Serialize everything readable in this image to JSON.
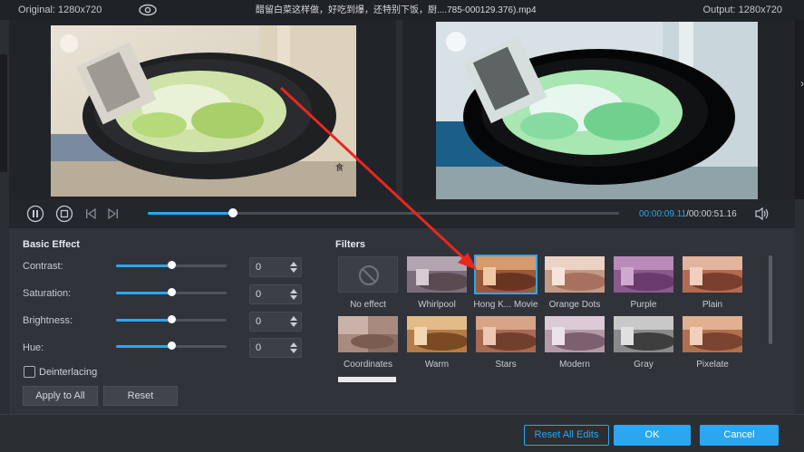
{
  "topbar": {
    "original_label": "Original: 1280x720",
    "title": "醋留白菜这样做，好吃到爆，还特别下饭，厨....785-000129.376).mp4",
    "output_label": "Output: 1280x720",
    "icon": "eye-icon"
  },
  "transport": {
    "time_current": "00:00:09.11",
    "time_total": "/00:00:51.16",
    "progress": 0.18,
    "icons": [
      "pause-icon",
      "stop-icon",
      "previous-frame-icon",
      "next-frame-icon",
      "volume-icon"
    ]
  },
  "basic_effect": {
    "title": "Basic Effect",
    "rows": [
      {
        "label": "Contrast:",
        "value": "0",
        "level": 0.5
      },
      {
        "label": "Saturation:",
        "value": "0",
        "level": 0.5
      },
      {
        "label": "Brightness:",
        "value": "0",
        "level": 0.5
      },
      {
        "label": "Hue:",
        "value": "0",
        "level": 0.5
      }
    ],
    "deinterlacing": "Deinterlacing",
    "apply_to_all": "Apply to All",
    "reset": "Reset"
  },
  "filters": {
    "title": "Filters",
    "items": [
      {
        "name": "No effect"
      },
      {
        "name": "Whirlpool"
      },
      {
        "name": "Hong K... Movie",
        "selected": true
      },
      {
        "name": "Orange Dots"
      },
      {
        "name": "Purple"
      },
      {
        "name": "Plain"
      },
      {
        "name": "Coordinates"
      },
      {
        "name": "Warm"
      },
      {
        "name": "Stars"
      },
      {
        "name": "Modern"
      },
      {
        "name": "Gray"
      },
      {
        "name": "Pixelate"
      }
    ]
  },
  "footer": {
    "reset_all": "Reset All Edits",
    "ok": "OK",
    "cancel": "Cancel"
  },
  "colors": {
    "accent": "#2aa7f0",
    "annotation_arrow": "#e8281e"
  }
}
